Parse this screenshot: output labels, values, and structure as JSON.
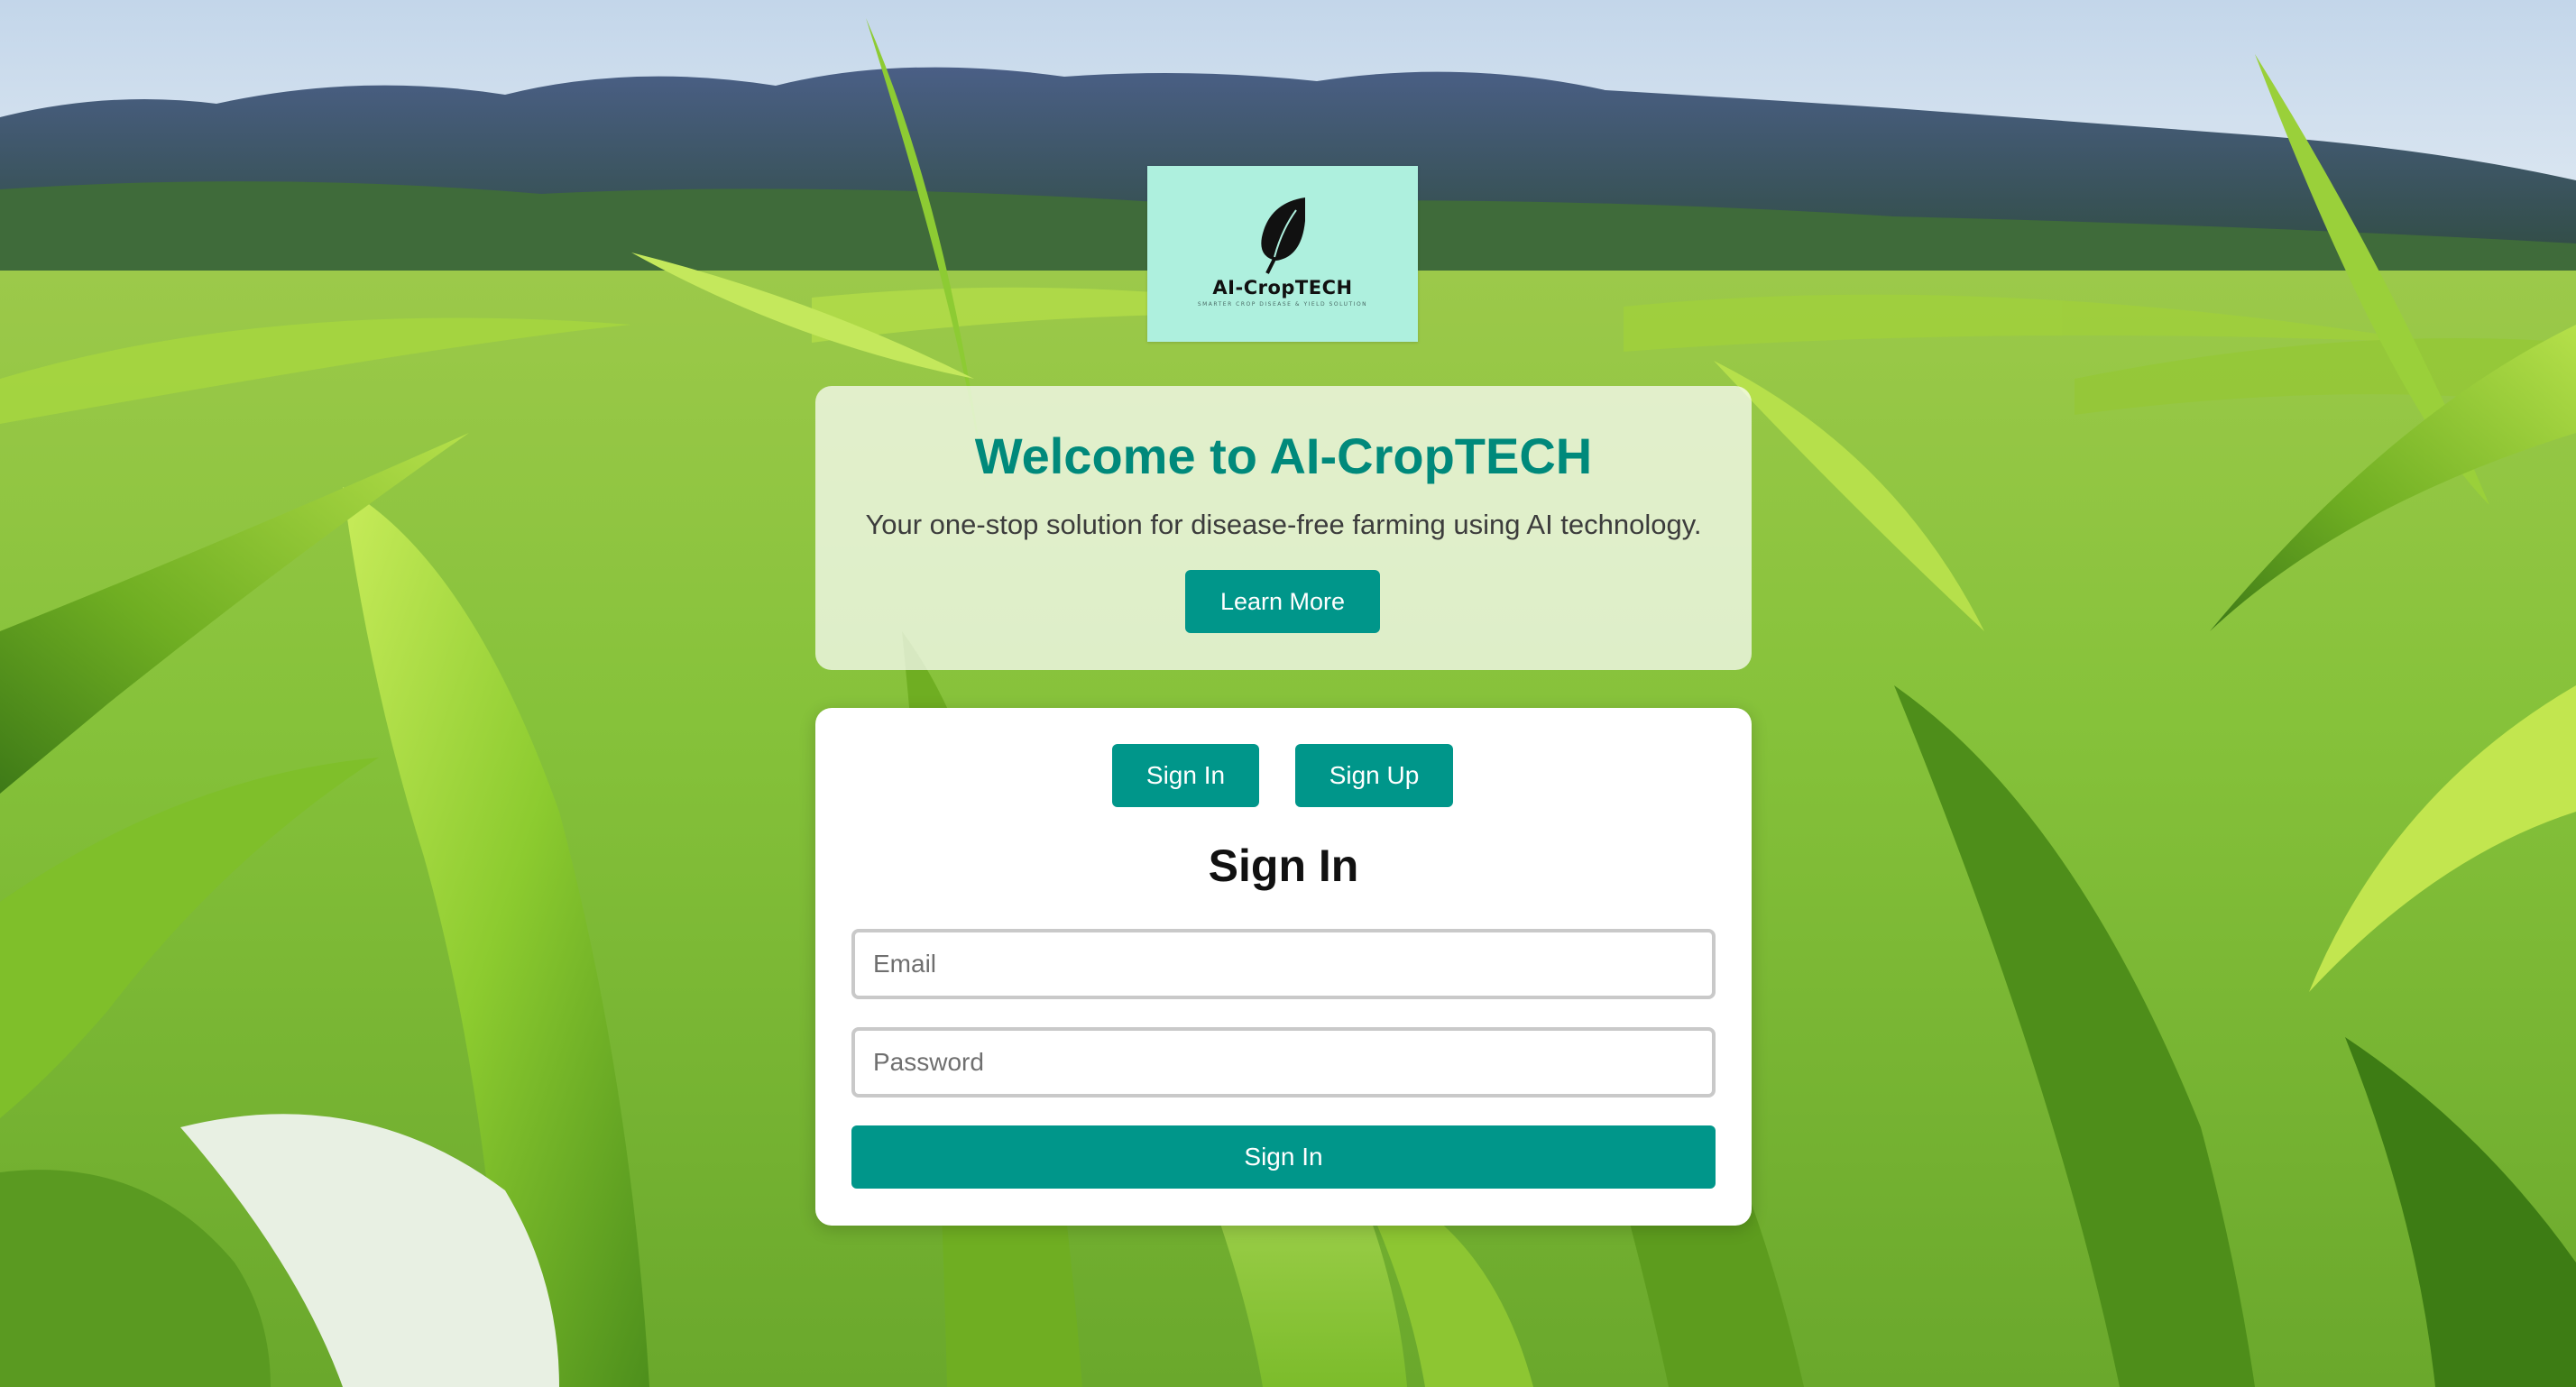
{
  "logo": {
    "brand_text": "AI-CropTECH",
    "tagline": "SMARTER CROP DISEASE & YIELD SOLUTION",
    "icon": "leaf-icon",
    "background_color": "#aef0de"
  },
  "hero": {
    "title_prefix": "Welcome to",
    "title_brand": "AI-CropTECH",
    "subtitle": "Your one-stop solution for disease-free farming using AI technology.",
    "learn_more_label": "Learn More"
  },
  "auth": {
    "tab_signin_label": "Sign In",
    "tab_signup_label": "Sign Up",
    "form_title": "Sign In",
    "email_placeholder": "Email",
    "password_placeholder": "Password",
    "submit_label": "Sign In"
  },
  "colors": {
    "accent": "#00968a",
    "heading": "#00897b"
  }
}
